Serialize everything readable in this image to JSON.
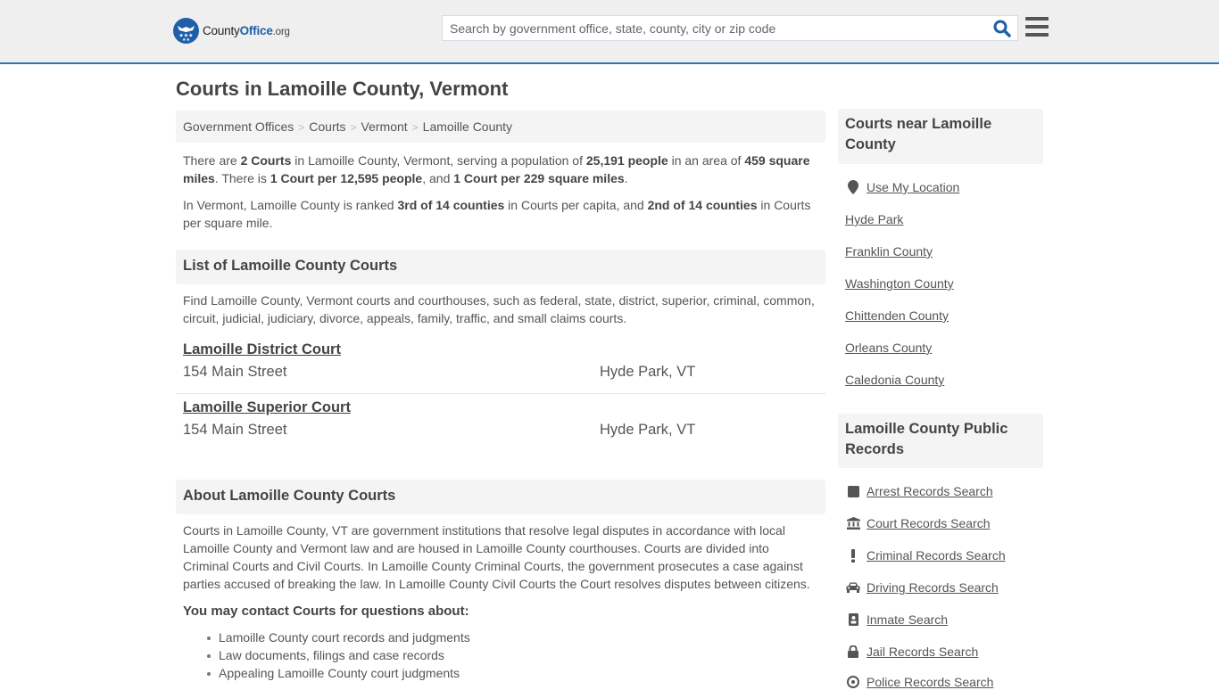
{
  "header": {
    "logo": {
      "part1": "County",
      "part2": "Office",
      "part3": ".org"
    },
    "search_placeholder": "Search by government office, state, county, city or zip code",
    "search_value": "",
    "colors": {
      "brand_blue": "#1f5fa8",
      "accent_line": "#2e75b6",
      "header_bg": "#efefef"
    }
  },
  "page": {
    "title": "Courts in Lamoille County, Vermont",
    "breadcrumb": [
      "Government Offices",
      "Courts",
      "Vermont",
      "Lamoille County"
    ],
    "summary": {
      "p1": {
        "t1": "There are ",
        "b1": "2 Courts",
        "t2": " in Lamoille County, Vermont, serving a population of ",
        "b2": "25,191 people",
        "t3": " in an area of ",
        "b3": "459 square miles",
        "t4": ". There is ",
        "b4": "1 Court per 12,595 people",
        "t5": ", and ",
        "b5": "1 Court per 229 square miles",
        "t6": "."
      },
      "p2": {
        "t1": "In Vermont, Lamoille County is ranked ",
        "b1": "3rd of 14 counties",
        "t2": " in Courts per capita, and ",
        "b2": "2nd of 14 counties",
        "t3": " in Courts per square mile."
      }
    },
    "list_section": {
      "heading": "List of Lamoille County Courts",
      "intro": "Find Lamoille County, Vermont courts and courthouses, such as federal, state, district, superior, criminal, common, circuit, judicial, judiciary, divorce, appeals, family, traffic, and small claims courts.",
      "courts": [
        {
          "name": "Lamoille District Court",
          "address": "154 Main Street",
          "city": "Hyde Park, VT"
        },
        {
          "name": "Lamoille Superior Court",
          "address": "154 Main Street",
          "city": "Hyde Park, VT"
        }
      ]
    },
    "about_section": {
      "heading": "About Lamoille County Courts",
      "body": "Courts in Lamoille County, VT are government institutions that resolve legal disputes in accordance with local Lamoille County and Vermont law and are housed in Lamoille County courthouses. Courts are divided into Criminal Courts and Civil Courts. In Lamoille County Criminal Courts, the government prosecutes a case against parties accused of breaking the law. In Lamoille County Civil Courts the Court resolves disputes between citizens.",
      "contact_heading": "You may contact Courts for questions about:",
      "contact_items": [
        "Lamoille County court records and judgments",
        "Law documents, filings and case records",
        "Appealing Lamoille County court judgments"
      ]
    }
  },
  "sidebar": {
    "nearby": {
      "heading": "Courts near Lamoille County",
      "use_location": {
        "label": "Use My Location",
        "icon": "map-marker-icon"
      },
      "links": [
        "Hyde Park",
        "Franklin County",
        "Washington County",
        "Chittenden County",
        "Orleans County",
        "Caledonia County"
      ]
    },
    "records": {
      "heading": "Lamoille County Public Records",
      "links": [
        {
          "label": "Arrest Records Search",
          "icon": "square-icon"
        },
        {
          "label": "Court Records Search",
          "icon": "courthouse-icon"
        },
        {
          "label": "Criminal Records Search",
          "icon": "exclamation-icon"
        },
        {
          "label": "Driving Records Search",
          "icon": "car-icon"
        },
        {
          "label": "Inmate Search",
          "icon": "id-badge-icon"
        },
        {
          "label": "Jail Records Search",
          "icon": "lock-icon"
        },
        {
          "label": "Police Records Search",
          "icon": "badge-icon"
        }
      ]
    }
  }
}
